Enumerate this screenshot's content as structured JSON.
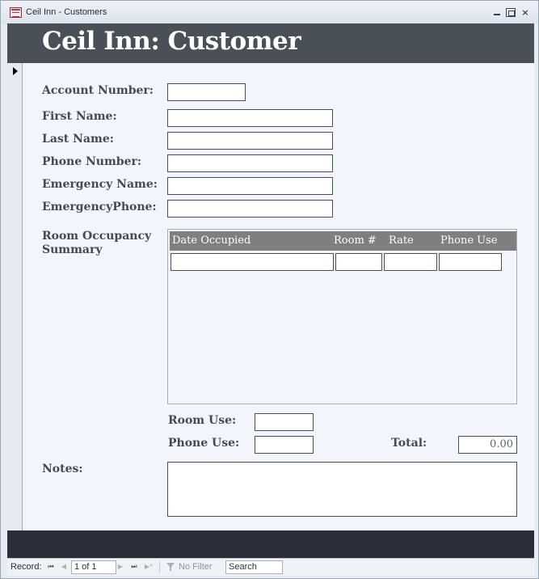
{
  "window": {
    "title": "Ceil Inn - Customers",
    "close_glyph": "×"
  },
  "form": {
    "title": "Ceil Inn: Customer"
  },
  "fields": {
    "account_number": {
      "label": "Account Number:",
      "value": ""
    },
    "first_name": {
      "label": "First Name:",
      "value": ""
    },
    "last_name": {
      "label": "Last Name:",
      "value": ""
    },
    "phone_number": {
      "label": "Phone Number:",
      "value": ""
    },
    "emergency_name": {
      "label": "Emergency Name:",
      "value": ""
    },
    "emergency_phone": {
      "label": "EmergencyPhone:",
      "value": ""
    }
  },
  "subform": {
    "label_line1": "Room Occupancy",
    "label_line2": "Summary",
    "columns": [
      "Date Occupied",
      "Room #",
      "Rate",
      "Phone Use"
    ]
  },
  "totals": {
    "room_use_label": "Room Use:",
    "room_use_value": "",
    "phone_use_label": "Phone Use:",
    "phone_use_value": "",
    "total_label": "Total:",
    "total_value": "0.00"
  },
  "notes": {
    "label": "Notes:",
    "value": ""
  },
  "navigation": {
    "record_label": "Record:",
    "first_glyph": "⏮",
    "prev_glyph": "◀",
    "next_glyph": "▶",
    "last_glyph": "⏭",
    "new_glyph": "▶*",
    "position": "1 of 1",
    "filter": "No Filter",
    "search": "Search"
  },
  "colors": {
    "header": "#4a5058",
    "footer": "#2a2e38",
    "detail_bg": "#f2f6fc",
    "label_text": "#404b59",
    "subform_header": "#7f7f7f"
  }
}
